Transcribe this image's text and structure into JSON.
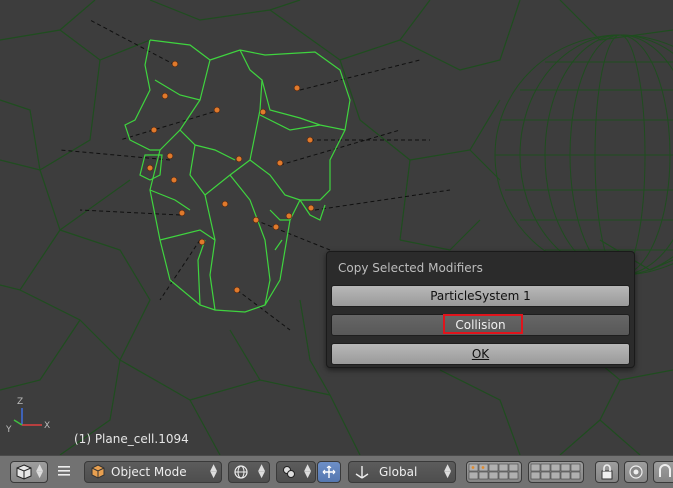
{
  "viewport": {
    "object_label": "(1) Plane_cell.1094",
    "axis_labels": {
      "x": "X",
      "y": "Y",
      "z": "Z"
    }
  },
  "popup": {
    "title": "Copy Selected Modifiers",
    "options": [
      "ParticleSystem 1",
      "Collision"
    ],
    "ok_label": "OK",
    "highlighted_option": "Collision"
  },
  "header": {
    "mode_label": "Object Mode",
    "orientation_label": "Global",
    "icons": [
      "editor-type-cube-icon",
      "menu-lines-icon",
      "object-mode-icon",
      "viewport-shading-icon",
      "pivot-point-icon",
      "manipulator-icon",
      "transform-orientation-icon",
      "layers-icon",
      "lock-icon",
      "render-icon",
      "snap-icon"
    ]
  },
  "colors": {
    "viewport_bg": "#3d3d3d",
    "wire": "#1e4a1e",
    "selected_wire": "#3fd43f",
    "origin_dot": "#e07a2c",
    "highlight": "#e0141c"
  }
}
